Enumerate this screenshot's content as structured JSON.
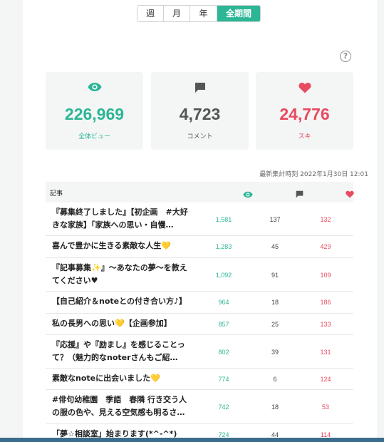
{
  "period_tabs": [
    {
      "label": "週",
      "active": false
    },
    {
      "label": "月",
      "active": false
    },
    {
      "label": "年",
      "active": false
    },
    {
      "label": "全期間",
      "active": true
    }
  ],
  "help_icon": "?",
  "summary": {
    "views": {
      "value": "226,969",
      "label": "全体ビュー",
      "color": "#2cb696",
      "icon": "eye-icon"
    },
    "comments": {
      "value": "4,723",
      "label": "コメント",
      "color": "#555555",
      "icon": "comment-icon"
    },
    "likes": {
      "value": "24,776",
      "label": "スキ",
      "color": "#e84a5f",
      "icon": "heart-icon"
    }
  },
  "updated_text": "最新集計時刻 2022年1月30日 12:01",
  "table": {
    "header_title": "記事",
    "rows": [
      {
        "title": "『募集終了しました』【初企画　#大好きな家族】「家族への思い・自慢…",
        "views": "1,581",
        "comments": "137",
        "likes": "132"
      },
      {
        "title": "喜んで豊かに生きる素敵な人生💛",
        "views": "1,283",
        "comments": "45",
        "likes": "429"
      },
      {
        "title": "『記事募集✨』〜あなたの夢〜を教えてください♥",
        "views": "1,092",
        "comments": "91",
        "likes": "109"
      },
      {
        "title": "【自己紹介＆noteとの付き合い方♪】",
        "views": "964",
        "comments": "18",
        "likes": "186"
      },
      {
        "title": "私の長男への思い💛【企画参加】",
        "views": "857",
        "comments": "25",
        "likes": "133"
      },
      {
        "title": "『応援』や『励まし』を感じることって？（魅力的なnoterさんもご紹…",
        "views": "802",
        "comments": "39",
        "likes": "131"
      },
      {
        "title": "素敵なnoteに出会いました💛",
        "views": "774",
        "comments": "6",
        "likes": "124"
      },
      {
        "title": "#俳句幼稚園　季語　春隣 行き交う人の服の色や、見える空気感も明るさ…",
        "views": "742",
        "comments": "18",
        "likes": "53"
      },
      {
        "title": "「夢☆相談室」始まります(*^-^*)",
        "views": "724",
        "comments": "44",
        "likes": "114"
      }
    ]
  }
}
